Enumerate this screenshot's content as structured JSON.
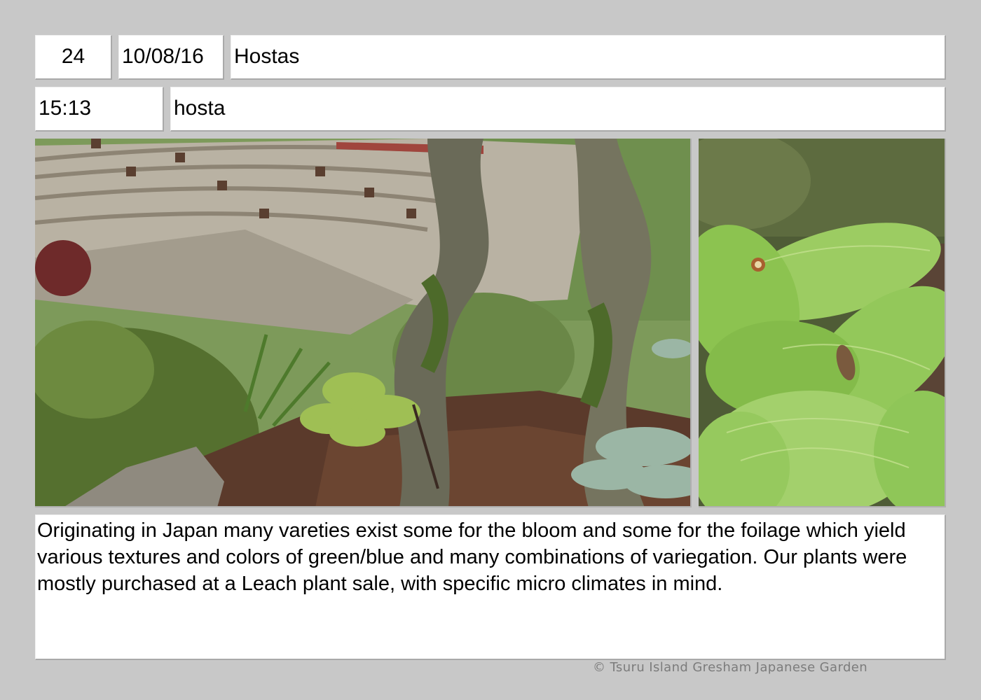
{
  "header": {
    "number": "24",
    "date": "10/08/16",
    "title": "Hostas"
  },
  "subheader": {
    "time": "15:13",
    "subject": "hosta"
  },
  "photos": {
    "main_icon": "garden-bridge-photo",
    "detail_icon": "hosta-leaves-photo"
  },
  "description": "Originating in Japan many vareties exist some for the bloom and some for the foilage which yield various textures and colors of green/blue and many combinations of variegation. Our plants were mostly purchased at a Leach plant sale, with specific micro climates in mind.",
  "footer": {
    "copyright": "© Tsuru Island Gresham Japanese Garden"
  },
  "colors": {
    "page_background": "#c8c8c8",
    "panel_background": "#ffffff",
    "footer_text": "#7c7c7c"
  }
}
